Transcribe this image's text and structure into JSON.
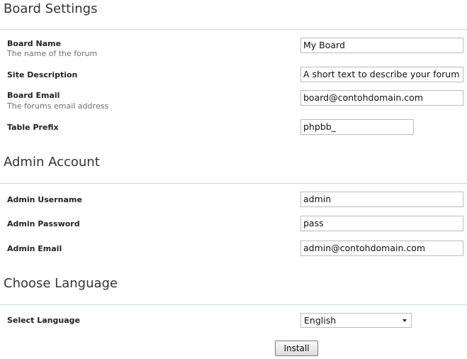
{
  "board_settings": {
    "title": "Board Settings",
    "board_name": {
      "label": "Board Name",
      "hint": "The name of the forum",
      "value": "My Board"
    },
    "site_description": {
      "label": "Site Description",
      "value": "A short text to describe your forum"
    },
    "board_email": {
      "label": "Board Email",
      "hint": "The forums email address",
      "value": "board@contohdomain.com"
    },
    "table_prefix": {
      "label": "Table Prefix",
      "value": "phpbb_"
    }
  },
  "admin_account": {
    "title": "Admin Account",
    "username": {
      "label": "Admin Username",
      "value": "admin"
    },
    "password": {
      "label": "Admin Password",
      "value": "pass"
    },
    "email": {
      "label": "Admin Email",
      "value": "admin@contohdomain.com"
    }
  },
  "language": {
    "title": "Choose Language",
    "select_label": "Select Language",
    "selected": "English"
  },
  "actions": {
    "install_label": "Install"
  },
  "colors": {
    "divider": "#c5dde6",
    "hint_text": "#6e6e6e",
    "input_border": "#bcbcbc"
  }
}
